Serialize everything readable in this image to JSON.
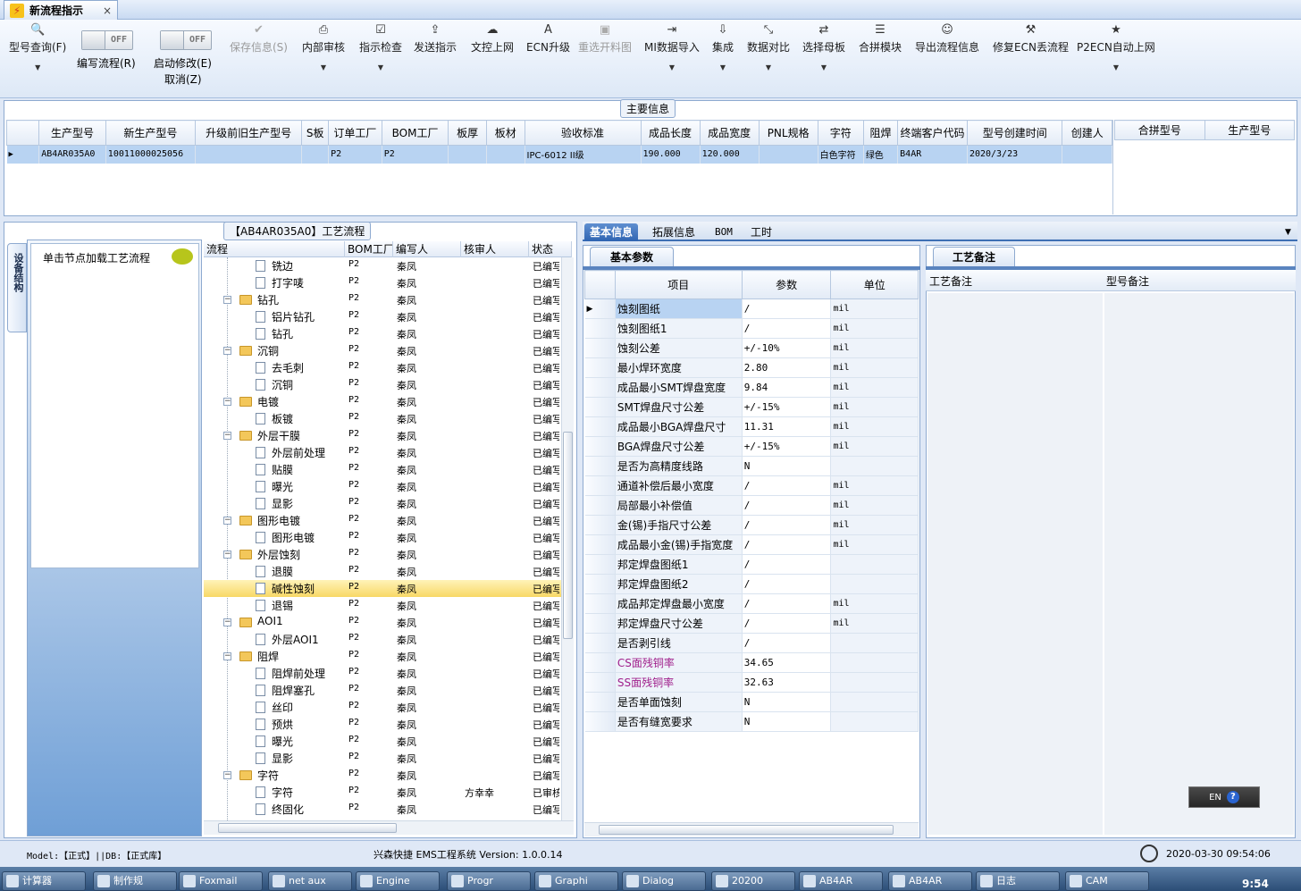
{
  "window": {
    "tab_title": "新流程指示",
    "close": "×"
  },
  "toolbar": {
    "query": "型号查询(F)",
    "edit_flow": "编写流程(R)",
    "toggle_off": "OFF",
    "start_modify": "启动修改(E)",
    "cancel": "取消(Z)",
    "save_info": "保存信息(S)",
    "internal_review": "内部审核",
    "instruction_check": "指示检查",
    "send_instruction": "发送指示",
    "doc_upload": "文控上网",
    "ecn_upgrade": "ECN升级",
    "reopen_drawing": "重选开料图",
    "mi_import": "MI数据导入",
    "integrate": "集成",
    "data_compare": "数据对比",
    "select_parent": "选择母板",
    "merge_module": "合拼模块",
    "export_flow": "导出流程信息",
    "fix_ecn": "修复ECN丢流程",
    "p2ecn": "P2ECN自动上网"
  },
  "main_info": {
    "caption": "主要信息",
    "columns": [
      "生产型号",
      "新生产型号",
      "升级前旧生产型号",
      "S板",
      "订单工厂",
      "BOM工厂",
      "板厚",
      "板材",
      "验收标准",
      "成品长度",
      "成品宽度",
      "PNL规格",
      "字符",
      "阻焊",
      "终端客户代码",
      "型号创建时间",
      "创建人"
    ],
    "row": [
      "AB4AR035A0",
      "10011000025056",
      "",
      "",
      "P2",
      "P2",
      "",
      "",
      "IPC-6012 II级",
      "190.000",
      "120.000",
      "",
      "白色字符",
      "绿色",
      "B4AR",
      "2020/3/23",
      ""
    ],
    "side_columns": [
      "合拼型号",
      "生产型号"
    ]
  },
  "process": {
    "title": "【AB4AR035A0】工艺流程",
    "side_tab": "设备结构",
    "nav_hint": "单击节点加载工艺流程",
    "columns": [
      "流程",
      "BOM工厂",
      "编写人",
      "核审人",
      "状态"
    ],
    "rows": [
      {
        "name": "铣边",
        "level": 1,
        "bom": "P2",
        "writer": "秦凤",
        "reviewer": "",
        "status": "已编写"
      },
      {
        "name": "打字唛",
        "level": 1,
        "bom": "P2",
        "writer": "秦凤",
        "reviewer": "",
        "status": "已编写"
      },
      {
        "name": "钻孔",
        "level": 0,
        "bom": "P2",
        "writer": "秦凤",
        "reviewer": "",
        "status": "已编写"
      },
      {
        "name": "铝片钻孔",
        "level": 1,
        "bom": "P2",
        "writer": "秦凤",
        "reviewer": "",
        "status": "已编写"
      },
      {
        "name": "钻孔",
        "level": 1,
        "bom": "P2",
        "writer": "秦凤",
        "reviewer": "",
        "status": "已编写"
      },
      {
        "name": "沉铜",
        "level": 0,
        "bom": "P2",
        "writer": "秦凤",
        "reviewer": "",
        "status": "已编写"
      },
      {
        "name": "去毛刺",
        "level": 1,
        "bom": "P2",
        "writer": "秦凤",
        "reviewer": "",
        "status": "已编写"
      },
      {
        "name": "沉铜",
        "level": 1,
        "bom": "P2",
        "writer": "秦凤",
        "reviewer": "",
        "status": "已编写"
      },
      {
        "name": "电镀",
        "level": 0,
        "bom": "P2",
        "writer": "秦凤",
        "reviewer": "",
        "status": "已编写"
      },
      {
        "name": "板镀",
        "level": 1,
        "bom": "P2",
        "writer": "秦凤",
        "reviewer": "",
        "status": "已编写"
      },
      {
        "name": "外层干膜",
        "level": 0,
        "bom": "P2",
        "writer": "秦凤",
        "reviewer": "",
        "status": "已编写"
      },
      {
        "name": "外层前处理",
        "level": 1,
        "bom": "P2",
        "writer": "秦凤",
        "reviewer": "",
        "status": "已编写"
      },
      {
        "name": "贴膜",
        "level": 1,
        "bom": "P2",
        "writer": "秦凤",
        "reviewer": "",
        "status": "已编写"
      },
      {
        "name": "曝光",
        "level": 1,
        "bom": "P2",
        "writer": "秦凤",
        "reviewer": "",
        "status": "已编写"
      },
      {
        "name": "显影",
        "level": 1,
        "bom": "P2",
        "writer": "秦凤",
        "reviewer": "",
        "status": "已编写"
      },
      {
        "name": "图形电镀",
        "level": 0,
        "bom": "P2",
        "writer": "秦凤",
        "reviewer": "",
        "status": "已编写"
      },
      {
        "name": "图形电镀",
        "level": 1,
        "bom": "P2",
        "writer": "秦凤",
        "reviewer": "",
        "status": "已编写"
      },
      {
        "name": "外层蚀刻",
        "level": 0,
        "bom": "P2",
        "writer": "秦凤",
        "reviewer": "",
        "status": "已编写"
      },
      {
        "name": "退膜",
        "level": 1,
        "bom": "P2",
        "writer": "秦凤",
        "reviewer": "",
        "status": "已编写"
      },
      {
        "name": "碱性蚀刻",
        "level": 1,
        "bom": "P2",
        "writer": "秦凤",
        "reviewer": "",
        "status": "已编写",
        "selected": true
      },
      {
        "name": "退锡",
        "level": 1,
        "bom": "P2",
        "writer": "秦凤",
        "reviewer": "",
        "status": "已编写"
      },
      {
        "name": "AOI1",
        "level": 0,
        "bom": "P2",
        "writer": "秦凤",
        "reviewer": "",
        "status": "已编写"
      },
      {
        "name": "外层AOI1",
        "level": 1,
        "bom": "P2",
        "writer": "秦凤",
        "reviewer": "",
        "status": "已编写"
      },
      {
        "name": "阻焊",
        "level": 0,
        "bom": "P2",
        "writer": "秦凤",
        "reviewer": "",
        "status": "已编写"
      },
      {
        "name": "阻焊前处理",
        "level": 1,
        "bom": "P2",
        "writer": "秦凤",
        "reviewer": "",
        "status": "已编写"
      },
      {
        "name": "阻焊塞孔",
        "level": 1,
        "bom": "P2",
        "writer": "秦凤",
        "reviewer": "",
        "status": "已编写"
      },
      {
        "name": "丝印",
        "level": 1,
        "bom": "P2",
        "writer": "秦凤",
        "reviewer": "",
        "status": "已编写"
      },
      {
        "name": "预烘",
        "level": 1,
        "bom": "P2",
        "writer": "秦凤",
        "reviewer": "",
        "status": "已编写"
      },
      {
        "name": "曝光",
        "level": 1,
        "bom": "P2",
        "writer": "秦凤",
        "reviewer": "",
        "status": "已编写"
      },
      {
        "name": "显影",
        "level": 1,
        "bom": "P2",
        "writer": "秦凤",
        "reviewer": "",
        "status": "已编写"
      },
      {
        "name": "字符",
        "level": 0,
        "bom": "P2",
        "writer": "秦凤",
        "reviewer": "",
        "status": "已编写"
      },
      {
        "name": "字符",
        "level": 1,
        "bom": "P2",
        "writer": "秦凤",
        "reviewer": "方幸幸",
        "status": "已审核"
      },
      {
        "name": "终固化",
        "level": 1,
        "bom": "P2",
        "writer": "秦凤",
        "reviewer": "",
        "status": "已编写"
      }
    ]
  },
  "tabs": {
    "basic": "基本信息",
    "extended": "拓展信息",
    "bom": "BOM",
    "hours": "工时"
  },
  "params": {
    "tab": "基本参数",
    "headers": [
      "项目",
      "参数",
      "单位"
    ],
    "rows": [
      {
        "item": "蚀刻图纸",
        "value": "/",
        "unit": "mil"
      },
      {
        "item": "蚀刻图纸1",
        "value": "/",
        "unit": "mil"
      },
      {
        "item": "蚀刻公差",
        "value": "+/-10%",
        "unit": "mil"
      },
      {
        "item": "最小焊环宽度",
        "value": "2.80",
        "unit": "mil"
      },
      {
        "item": "成品最小SMT焊盘宽度",
        "value": "9.84",
        "unit": "mil"
      },
      {
        "item": "SMT焊盘尺寸公差",
        "value": "+/-15%",
        "unit": "mil"
      },
      {
        "item": "成品最小BGA焊盘尺寸",
        "value": "11.31",
        "unit": "mil"
      },
      {
        "item": "BGA焊盘尺寸公差",
        "value": "+/-15%",
        "unit": "mil"
      },
      {
        "item": "是否为高精度线路",
        "value": "N",
        "unit": ""
      },
      {
        "item": "通道补偿后最小宽度",
        "value": "/",
        "unit": "mil"
      },
      {
        "item": "局部最小补偿值",
        "value": "/",
        "unit": "mil"
      },
      {
        "item": "金(锡)手指尺寸公差",
        "value": "/",
        "unit": "mil"
      },
      {
        "item": "成品最小金(锡)手指宽度",
        "value": "/",
        "unit": "mil"
      },
      {
        "item": "邦定焊盘图纸1",
        "value": "/",
        "unit": ""
      },
      {
        "item": "邦定焊盘图纸2",
        "value": "/",
        "unit": ""
      },
      {
        "item": "成品邦定焊盘最小宽度",
        "value": "/",
        "unit": "mil"
      },
      {
        "item": "邦定焊盘尺寸公差",
        "value": "/",
        "unit": "mil"
      },
      {
        "item": "是否剥引线",
        "value": "/",
        "unit": ""
      },
      {
        "item": "CS面残铜率",
        "value": "34.65",
        "unit": "",
        "magenta": true
      },
      {
        "item": "SS面残铜率",
        "value": "32.63",
        "unit": "",
        "magenta": true
      },
      {
        "item": "是否单面蚀刻",
        "value": "N",
        "unit": ""
      },
      {
        "item": "是否有缝宽要求",
        "value": "N",
        "unit": ""
      }
    ]
  },
  "notes": {
    "tab": "工艺备注",
    "col1": "工艺备注",
    "col2": "型号备注"
  },
  "lang": {
    "code": "EN",
    "help": "?"
  },
  "status": {
    "left": "Model:【正式】||DB:【正式库】",
    "center": "兴森快捷 EMS工程系统 Version: 1.0.0.14",
    "datetime": "2020-03-30 09:54:06"
  },
  "taskbar": {
    "items": [
      "计算器",
      "制作规",
      "Foxmail",
      "net aux",
      "Engine",
      "Progr",
      "Graphi",
      "Dialog",
      "20200",
      "AB4AR",
      "AB4AR",
      "日志",
      "CAM"
    ],
    "clock": "9:54"
  }
}
